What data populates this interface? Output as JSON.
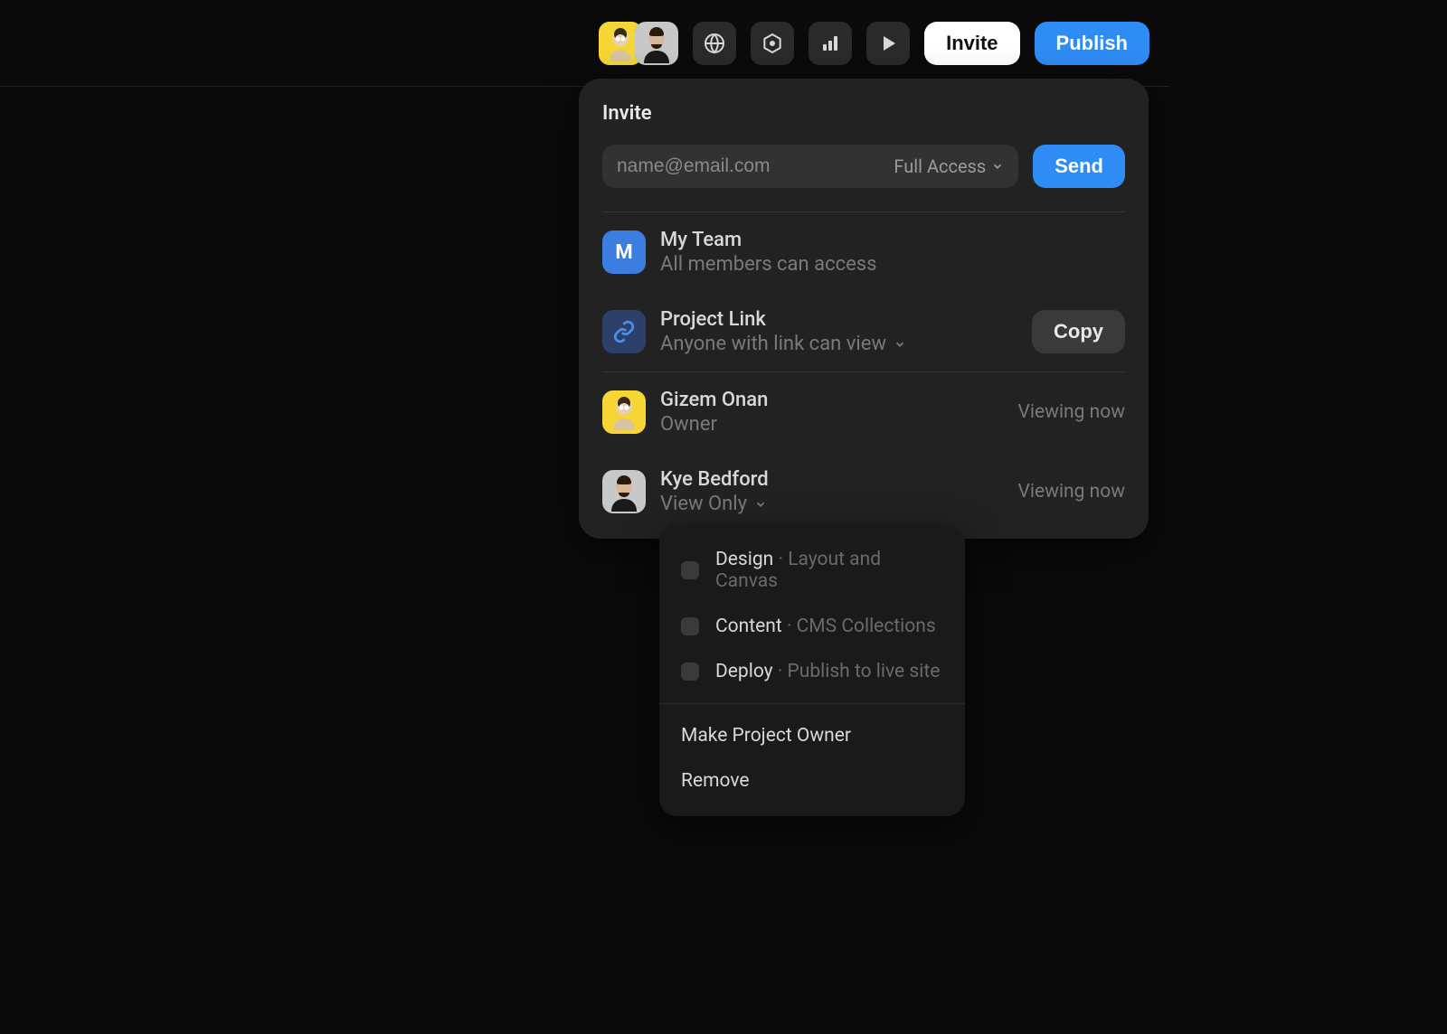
{
  "topbar": {
    "invite_label": "Invite",
    "publish_label": "Publish"
  },
  "modal": {
    "title": "Invite",
    "email_placeholder": "name@email.com",
    "access_label": "Full Access",
    "send_label": "Send",
    "team": {
      "avatar_letter": "M",
      "name": "My Team",
      "sub": "All members can access"
    },
    "link": {
      "name": "Project Link",
      "sub": "Anyone with link can view",
      "copy_label": "Copy"
    },
    "members": [
      {
        "name": "Gizem Onan",
        "role": "Owner",
        "status": "Viewing now"
      },
      {
        "name": "Kye Bedford",
        "role": "View Only",
        "status": "Viewing now"
      }
    ]
  },
  "submenu": {
    "options": [
      {
        "label": "Design",
        "desc": "Layout and Canvas"
      },
      {
        "label": "Content",
        "desc": "CMS Collections"
      },
      {
        "label": "Deploy",
        "desc": "Publish to live site"
      }
    ],
    "make_owner": "Make Project Owner",
    "remove": "Remove"
  },
  "colors": {
    "accent_blue": "#2f8cf4",
    "accent_yellow": "#f5d635"
  }
}
